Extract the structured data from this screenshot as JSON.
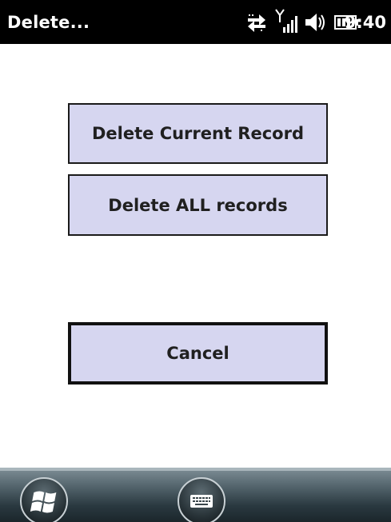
{
  "titlebar": {
    "title": "Delete...",
    "time": "9:40"
  },
  "status_icons": [
    "connectivity-icon",
    "signal-icon",
    "volume-icon",
    "battery-icon"
  ],
  "buttons": {
    "delete_current": "Delete Current Record",
    "delete_all": "Delete ALL records",
    "cancel": "Cancel"
  },
  "taskbar": {
    "icons": [
      "windows-start-icon",
      "keyboard-icon"
    ]
  },
  "colors": {
    "button_fill": "#d6d6f0",
    "title_bar": "#000000",
    "background": "#ffffff"
  }
}
